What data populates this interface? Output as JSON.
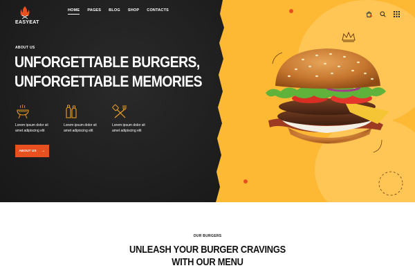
{
  "brand": {
    "name": "EASYEAT",
    "logo_icon": "flame-forks-icon"
  },
  "nav": {
    "items": [
      {
        "label": "HOME",
        "active": true
      },
      {
        "label": "PAGES"
      },
      {
        "label": "BLOG"
      },
      {
        "label": "SHOP"
      },
      {
        "label": "CONTACTS"
      }
    ]
  },
  "header_icons": [
    "bag-icon",
    "search-icon",
    "grid-menu-icon"
  ],
  "hero": {
    "eyebrow": "ABOUT US",
    "title_line1": "UNFORGETTABLE BURGERS,",
    "title_line2": "UNFORGETTABLE MEMORIES",
    "features": [
      {
        "icon": "grill-icon",
        "line1": "Lorem ipsum dolor sit",
        "line2": "amet adipiscing elit"
      },
      {
        "icon": "sauce-bottles-icon",
        "line1": "Lorem ipsum dolor sit",
        "line2": "amet adipiscing elit"
      },
      {
        "icon": "spatula-fork-icon",
        "line1": "Lorem ipsum dolor sit",
        "line2": "amet adipiscing elit"
      }
    ],
    "cta_label": "ABOUT US"
  },
  "colors": {
    "accent": "#e8501f",
    "yellow": "#fdb934",
    "dark": "#161616"
  },
  "menu_section": {
    "eyebrow": "OUR BURGERS",
    "title_line1": "UNLEASH YOUR BURGER CRAVINGS",
    "title_line2": "WITH OUR MENU"
  }
}
